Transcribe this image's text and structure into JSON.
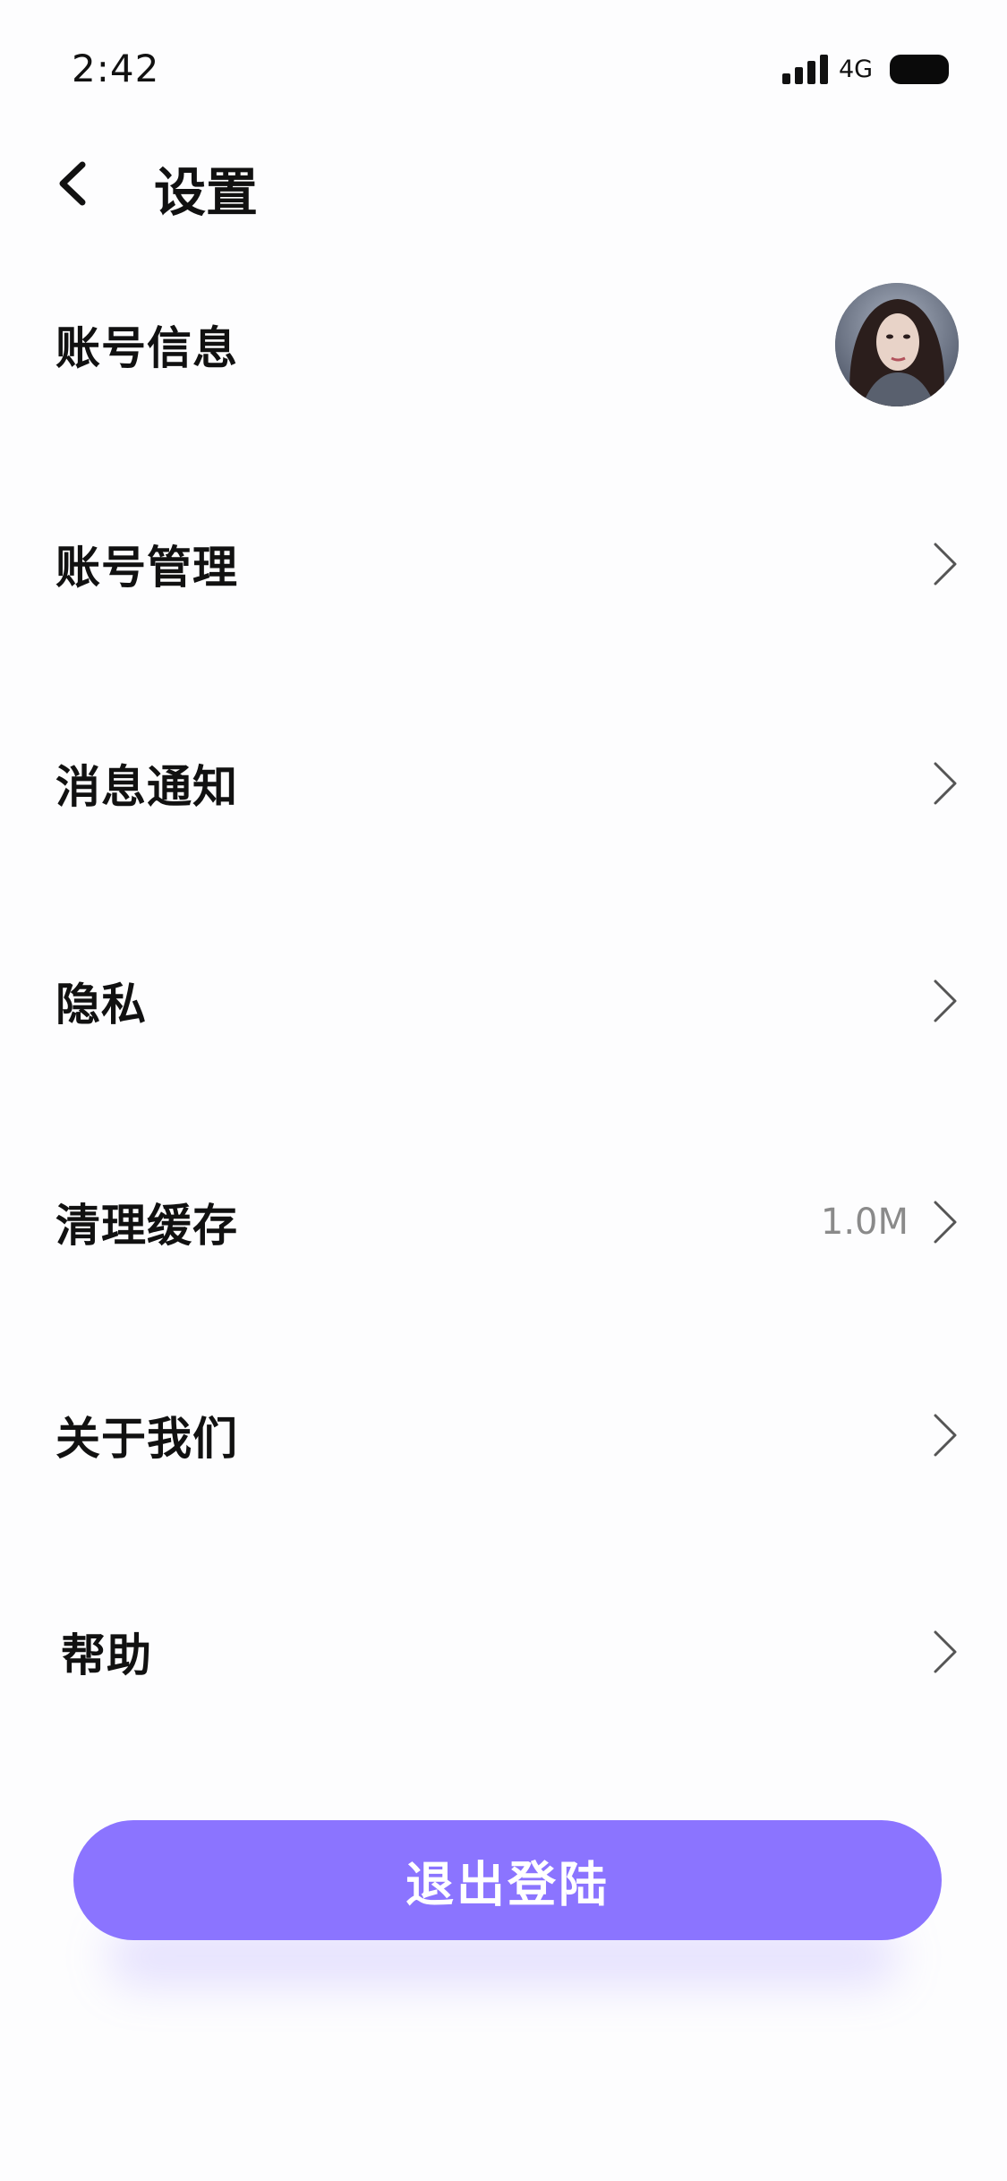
{
  "status_bar": {
    "time": "2:42",
    "network": "4G",
    "signal_icon": "signal-bars-icon",
    "battery_icon": "battery-icon"
  },
  "header": {
    "back_icon": "chevron-left-icon",
    "title": "设置"
  },
  "settings": {
    "items": [
      {
        "label": "账号信息",
        "trailing": "avatar"
      },
      {
        "label": "账号管理",
        "trailing": "chevron-right-icon"
      },
      {
        "label": "消息通知",
        "trailing": "chevron-right-icon"
      },
      {
        "label": "隐私",
        "trailing": "chevron-right-icon"
      },
      {
        "label": "清理缓存",
        "value": "1.0M",
        "trailing": "chevron-right-icon"
      },
      {
        "label": "关于我们",
        "trailing": "chevron-right-icon"
      },
      {
        "label": "帮助",
        "trailing": "chevron-right-icon"
      }
    ]
  },
  "logout": {
    "label": "退出登陆"
  },
  "colors": {
    "accent": "#8b74ff",
    "text": "#111111",
    "secondary_text": "#8a8a8a",
    "chevron": "#555555"
  }
}
